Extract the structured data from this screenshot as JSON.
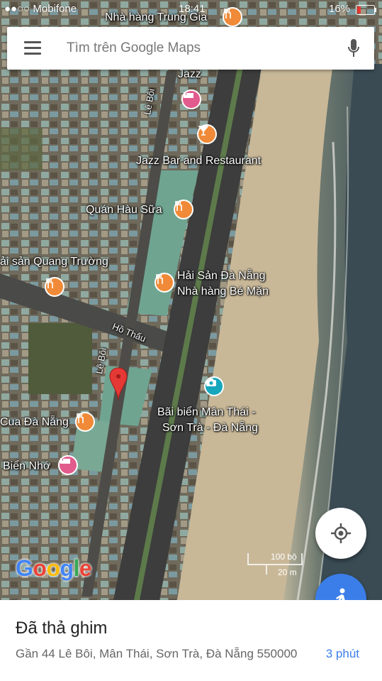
{
  "status_bar": {
    "carrier": "●●○○ Mobifone",
    "time": "18:41",
    "battery": "16%"
  },
  "search": {
    "placeholder": "Tìm trên Google Maps"
  },
  "map_labels": {
    "top_restaurant": "Nhà hàng Trung Gia",
    "jazz": "Jazz",
    "jazz_bar": "Jazz Bar and Restaurant",
    "le_boi_1": "Lê Bôi",
    "quan_hau_sua": "Quán Hàu Sữa",
    "hai_san_quang_truong": "ải sản Quang Trường",
    "hai_san_da_nang": "Hải Sản Đà Nẵng",
    "nha_hang_be_man": "Nhà hàng Bé Mặn",
    "ho_thau": "Hồ Thấu",
    "le_boi_2": "Lê Bôi",
    "beach_line1": "Bãi biển Mân Thái -",
    "beach_line2": "Sơn Trà - Đà Nẵng",
    "cua_da_nang": "Cua Đà Nẵng",
    "bien_nho": "Biển Nhớ"
  },
  "scale": {
    "feet": "100 bộ",
    "meters": "20 m"
  },
  "logo": "Google",
  "bottom_sheet": {
    "title": "Đã thả ghim",
    "address": "Gần 44 Lê Bôi, Mân Thái, Sơn Trà, Đà Nẵng 550000",
    "eta": "3 phút"
  },
  "colors": {
    "accent": "#3b7ee9",
    "pin_red": "#e53935",
    "poi_orange": "#f08a38",
    "poi_pink": "#e15b8c",
    "poi_teal": "#17a7bd"
  }
}
